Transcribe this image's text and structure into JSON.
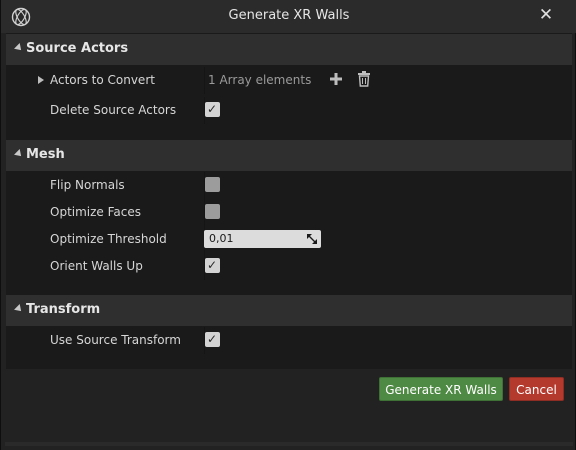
{
  "window": {
    "title": "Generate XR Walls",
    "close_symbol": "✕",
    "logo_icon": "unreal-logo-icon"
  },
  "categories": {
    "source_actors": {
      "label": "Source Actors",
      "actors_to_convert": {
        "label": "Actors to Convert",
        "value": "1 Array elements",
        "add_icon": "plus-icon",
        "delete_icon": "trash-icon"
      },
      "delete_source_actors": {
        "label": "Delete Source Actors",
        "checked": true
      }
    },
    "mesh": {
      "label": "Mesh",
      "flip_normals": {
        "label": "Flip Normals",
        "checked": false
      },
      "optimize_faces": {
        "label": "Optimize Faces",
        "checked": false
      },
      "optimize_threshold": {
        "label": "Optimize Threshold",
        "value": "0,01"
      },
      "orient_walls_up": {
        "label": "Orient Walls Up",
        "checked": true
      }
    },
    "transform": {
      "label": "Transform",
      "use_source_transform": {
        "label": "Use Source Transform",
        "checked": true
      }
    }
  },
  "buttons": {
    "generate": "Generate XR Walls",
    "cancel": "Cancel"
  },
  "colors": {
    "generate_button": "#4f8a44",
    "cancel_button": "#b53a2e"
  }
}
